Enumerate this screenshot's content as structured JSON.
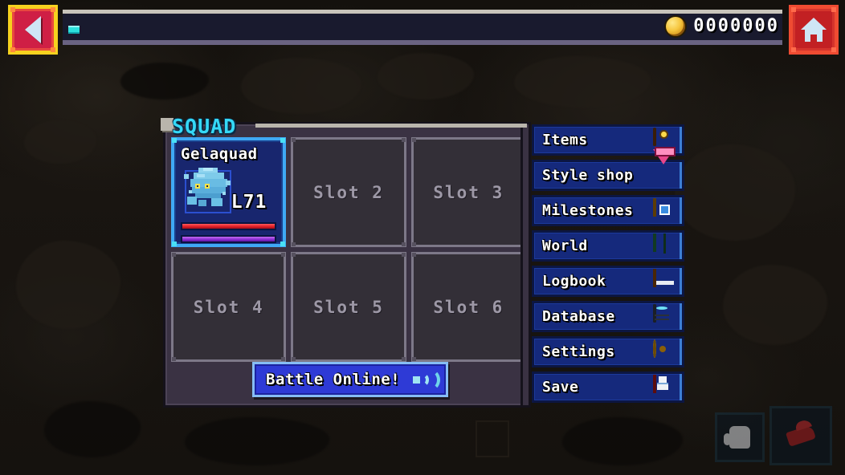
{
  "topbar": {
    "back_button": {
      "label": "",
      "icon": "back-arrow-icon"
    },
    "home_button": {
      "label": "",
      "icon": "home-icon"
    },
    "currency": {
      "icon": "coin-icon",
      "amount": "0000000"
    },
    "indicator": {
      "name": "status-indicator",
      "color": "#2ce0dc"
    }
  },
  "squad": {
    "title": "SQUAD",
    "slots": [
      {
        "index": 1,
        "filled": true,
        "name": "Gelaquad",
        "level": "L71",
        "sprite": "blue-gel-creature-sprite",
        "hp_percent": 100,
        "xp_percent": 100,
        "hp_color": "#e01f28",
        "xp_color": "#8d2fd6"
      },
      {
        "index": 2,
        "filled": false,
        "label": "Slot 2"
      },
      {
        "index": 3,
        "filled": false,
        "label": "Slot 3"
      },
      {
        "index": 4,
        "filled": false,
        "label": "Slot 4"
      },
      {
        "index": 5,
        "filled": false,
        "label": "Slot 5"
      },
      {
        "index": 6,
        "filled": false,
        "label": "Slot 6"
      }
    ],
    "battle_button": {
      "label": "Battle Online!",
      "icon": "wifi-broadcast-icon"
    }
  },
  "menu": {
    "items": [
      {
        "label": "Items",
        "icon": "treasure-bag-icon"
      },
      {
        "label": "Style shop",
        "icon": "pink-gem-icon"
      },
      {
        "label": "Milestones",
        "icon": "gold-medal-icon"
      },
      {
        "label": "World",
        "icon": "world-map-icon"
      },
      {
        "label": "Logbook",
        "icon": "orange-book-icon"
      },
      {
        "label": "Database",
        "icon": "server-database-icon"
      },
      {
        "label": "Settings",
        "icon": "gear-icon"
      },
      {
        "label": "Save",
        "icon": "floppy-disk-icon"
      }
    ]
  },
  "hud_actions": [
    {
      "name": "grab-hand-button",
      "icon": "hand-icon"
    },
    {
      "name": "run-shoe-button",
      "icon": "shoe-icon"
    }
  ],
  "theme": {
    "accent_cyan": "#35d9f7",
    "panel_bg": "#3a3243",
    "menu_blue": "#15297c",
    "card_blue": "#18266e",
    "card_border": "#3fa9f5"
  }
}
